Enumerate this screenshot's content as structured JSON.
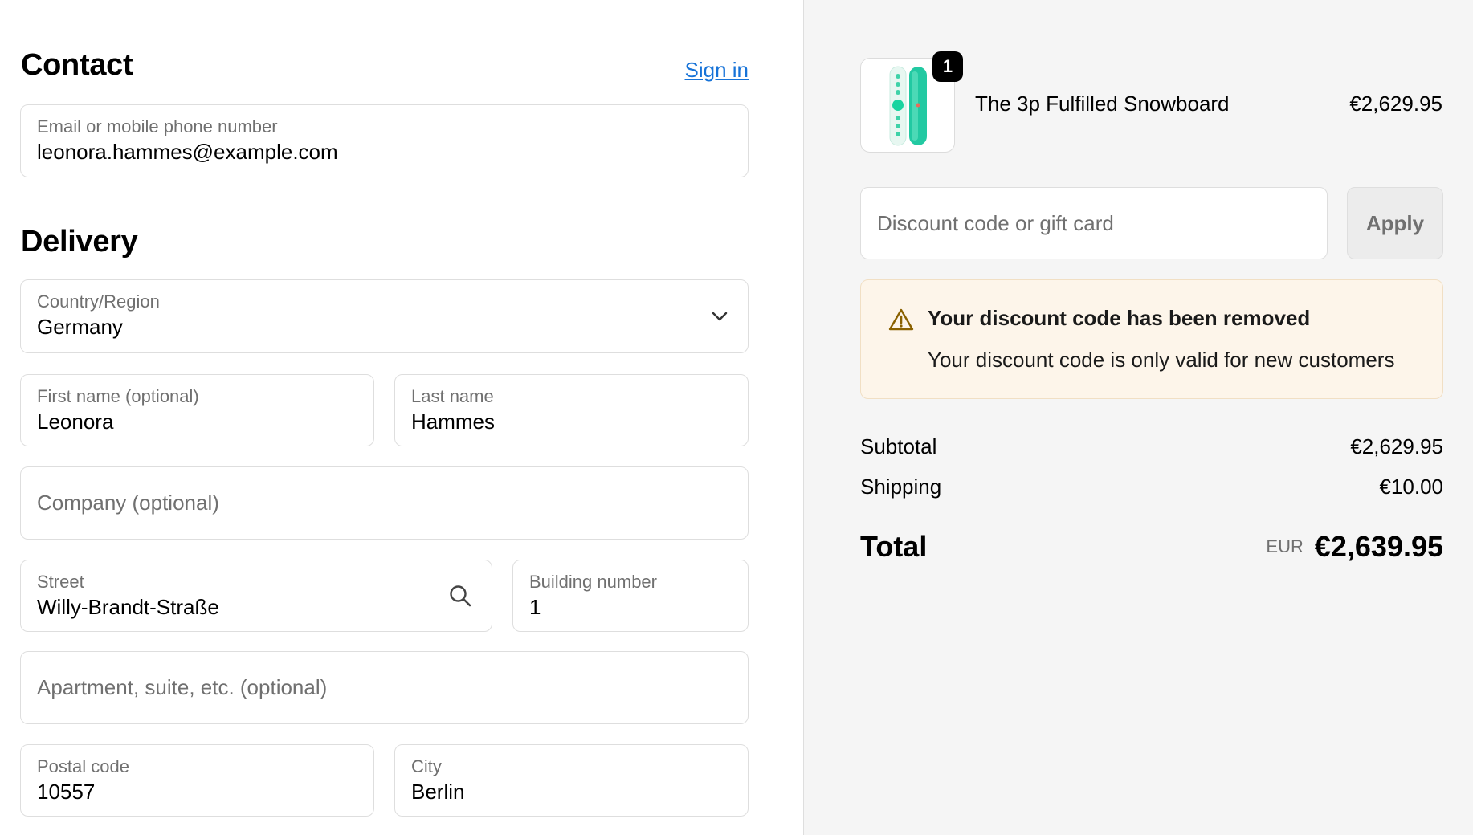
{
  "contact": {
    "heading": "Contact",
    "sign_in": "Sign in",
    "email_label": "Email or mobile phone number",
    "email_value": "leonora.hammes@example.com"
  },
  "delivery": {
    "heading": "Delivery",
    "country_label": "Country/Region",
    "country_value": "Germany",
    "first_name_label": "First name (optional)",
    "first_name_value": "Leonora",
    "last_name_label": "Last name",
    "last_name_value": "Hammes",
    "company_placeholder": "Company (optional)",
    "street_label": "Street",
    "street_value": "Willy-Brandt-Straße",
    "building_label": "Building number",
    "building_value": "1",
    "apartment_placeholder": "Apartment, suite, etc. (optional)",
    "postal_label": "Postal code",
    "postal_value": "10557",
    "city_label": "City",
    "city_value": "Berlin"
  },
  "summary": {
    "product_name": "The 3p Fulfilled Snowboard",
    "product_price": "€2,629.95",
    "product_quantity": "1",
    "discount_placeholder": "Discount code or gift card",
    "apply_label": "Apply",
    "notice_title": "Your discount code has been removed",
    "notice_body": "Your discount code is only valid for new customers",
    "subtotal_label": "Subtotal",
    "subtotal_value": "€2,629.95",
    "shipping_label": "Shipping",
    "shipping_value": "€10.00",
    "total_label": "Total",
    "total_currency": "EUR",
    "total_value": "€2,639.95"
  },
  "icons": {
    "dropdown": "chevron-down-icon",
    "search": "search-icon",
    "warning": "warning-icon"
  },
  "colors": {
    "link": "#1773d8",
    "notice_bg": "#fdf5ea",
    "notice_border": "#f1dfc4",
    "warning_icon": "#8a6100"
  }
}
